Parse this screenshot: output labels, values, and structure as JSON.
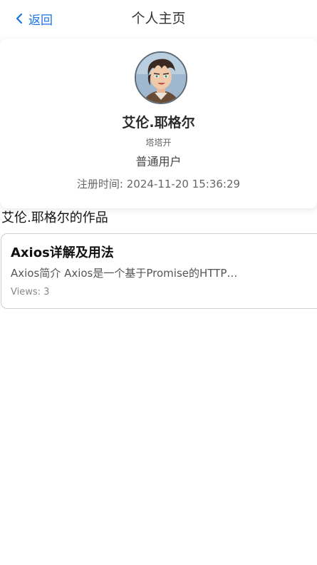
{
  "nav": {
    "back_label": "返回",
    "title": "个人主页"
  },
  "profile": {
    "name": "艾伦.耶格尔",
    "nickname": "塔塔开",
    "role": "普通用户",
    "register_time": "注册时间: 2024-11-20 15:36:29"
  },
  "works": {
    "heading": "艾伦.耶格尔的作品",
    "items": [
      {
        "title": "Axios详解及用法",
        "excerpt": "Axios简介 Axios是一个基于Promise的HTTP…",
        "views": "Views: 3"
      }
    ]
  },
  "colors": {
    "accent": "#1a73e8",
    "card_border": "#cfcfcf"
  },
  "icons": {
    "back": "chevron-left-icon",
    "avatar": "user-avatar"
  }
}
